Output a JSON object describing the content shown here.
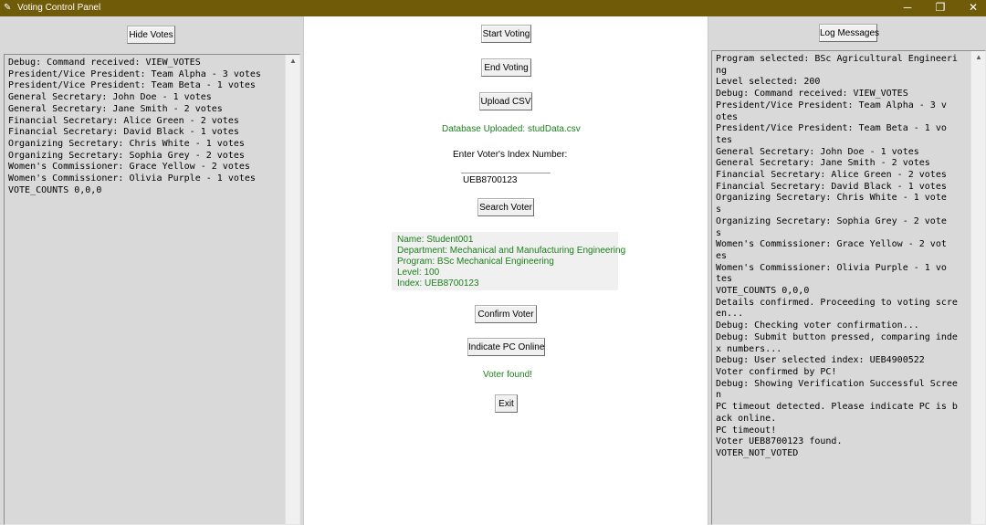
{
  "window": {
    "title": "Voting Control Panel",
    "controls": {
      "minimize": "─",
      "maximize": "❐",
      "close": "✕"
    }
  },
  "left_panel": {
    "hide_votes_label": "Hide Votes",
    "log_lines": [
      "Debug: Command received: VIEW_VOTES",
      "President/Vice President: Team Alpha - 3 votes",
      "President/Vice President: Team Beta - 1 votes",
      "General Secretary: John Doe - 1 votes",
      "General Secretary: Jane Smith - 2 votes",
      "Financial Secretary: Alice Green - 2 votes",
      "Financial Secretary: David Black - 1 votes",
      "Organizing Secretary: Chris White - 1 votes",
      "Organizing Secretary: Sophia Grey - 2 votes",
      "Women's Commissioner: Grace Yellow - 2 votes",
      "Women's Commissioner: Olivia Purple - 1 votes",
      "VOTE_COUNTS 0,0,0"
    ]
  },
  "center_panel": {
    "start_voting_label": "Start Voting",
    "end_voting_label": "End Voting",
    "upload_csv_label": "Upload CSV",
    "upload_status": "Database Uploaded: studData.csv",
    "index_prompt": "Enter Voter's Index Number:",
    "index_value": "UEB8700123",
    "search_voter_label": "Search Voter",
    "voter_info": {
      "name": "Name: Student001",
      "department": "Department: Mechanical and Manufacturing Engineering",
      "program": "Program: BSc Mechanical Engineering",
      "level": "Level: 100",
      "index": "Index: UEB8700123"
    },
    "confirm_voter_label": "Confirm Voter",
    "indicate_pc_online_label": "Indicate PC Online",
    "voter_status": "Voter found!",
    "exit_label": "Exit"
  },
  "right_panel": {
    "log_messages_label": "Log Messages",
    "log_lines": [
      "Program selected: BSc Agricultural Engineeri",
      "ng",
      "Level selected: 200",
      "Debug: Command received: VIEW_VOTES",
      "President/Vice President: Team Alpha - 3 v",
      "otes",
      "President/Vice President: Team Beta - 1 vo",
      "tes",
      "General Secretary: John Doe - 1 votes",
      "General Secretary: Jane Smith - 2 votes",
      "Financial Secretary: Alice Green - 2 votes",
      "Financial Secretary: David Black - 1 votes",
      "Organizing Secretary: Chris White - 1 vote",
      "s",
      "Organizing Secretary: Sophia Grey - 2 vote",
      "s",
      "Women's Commissioner: Grace Yellow - 2 vot",
      "es",
      "Women's Commissioner: Olivia Purple - 1 vo",
      "tes",
      "VOTE_COUNTS 0,0,0",
      "Details confirmed. Proceeding to voting scre",
      "en...",
      "Debug: Checking voter confirmation...",
      "Debug: Submit button pressed, comparing inde",
      "x numbers...",
      "Debug: User selected index: UEB4900522",
      "Voter confirmed by PC!",
      "Debug: Showing Verification Successful Scree",
      "n",
      "PC timeout detected. Please indicate PC is b",
      "ack online.",
      "PC timeout!",
      "Voter UEB8700123 found.",
      "VOTER_NOT_VOTED"
    ]
  }
}
